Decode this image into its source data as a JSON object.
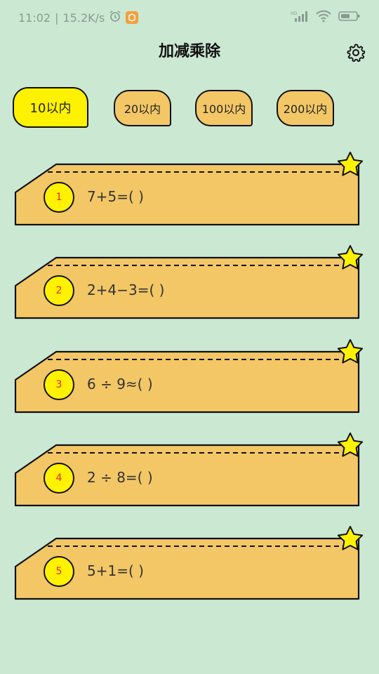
{
  "status_bar": {
    "time": "11:02",
    "speed": "15.2K/s",
    "icons": [
      "alarm-icon",
      "app-icon",
      "hd-signal-icon",
      "wifi-icon",
      "battery-icon"
    ]
  },
  "header": {
    "title": "加减乘除",
    "settings_icon": "gear-icon"
  },
  "tabs": [
    {
      "label": "10以内",
      "active": true
    },
    {
      "label": "20以内",
      "active": false
    },
    {
      "label": "100以内",
      "active": false
    },
    {
      "label": "200以内",
      "active": false
    }
  ],
  "questions": [
    {
      "number": "1",
      "text": "7+5=( )"
    },
    {
      "number": "2",
      "text": "2+4−3=( )"
    },
    {
      "number": "3",
      "text": "6 ÷ 9≈( )"
    },
    {
      "number": "4",
      "text": "2 ÷ 8=( )"
    },
    {
      "number": "5",
      "text": "5+1=( )"
    }
  ],
  "colors": {
    "background": "#cbe8d2",
    "card": "#f3c766",
    "active_tab": "#fff200",
    "number_text": "#e8223a"
  }
}
